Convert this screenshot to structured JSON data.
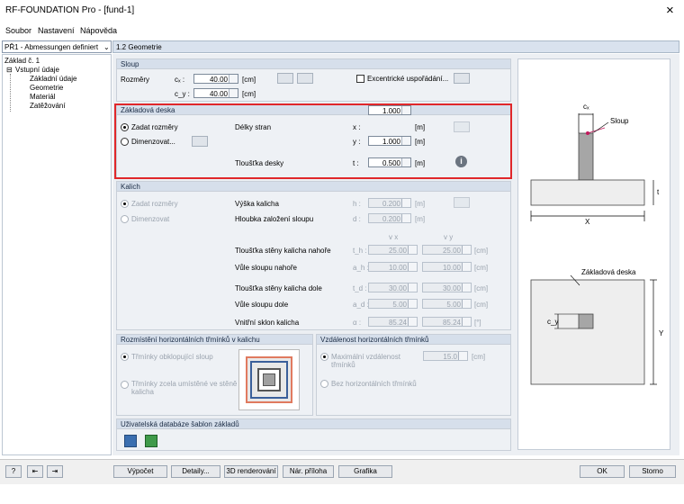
{
  "window": {
    "title": "RF-FOUNDATION Pro - [fund-1]",
    "close": "×"
  },
  "menu": [
    "Soubor",
    "Nastavení",
    "Nápověda"
  ],
  "case_combo": "PŘ1 - Abmessungen definiert",
  "pane_title": "1.2 Geometrie",
  "tree": {
    "root": "Základ č. 1",
    "input": "Vstupní údaje",
    "items": [
      "Základní údaje",
      "Geometrie",
      "Materiál",
      "Zatěžování"
    ]
  },
  "sloup": {
    "title": "Sloup",
    "rozmery": "Rozměry",
    "cx_label": "cₓ :",
    "cy_label": "c_y :",
    "cx": "40.00",
    "cy": "40.00",
    "unit": "[cm]",
    "excentric": "Excentrické uspořádání..."
  },
  "deska": {
    "title": "Základová deska",
    "zadat": "Zadat rozměry",
    "dimenzovat": "Dimenzovat...",
    "delky": "Délky stran",
    "x_label": "x :",
    "y_label": "y :",
    "x": "1.000",
    "y": "1.000",
    "unit": "[m]",
    "tloustka": "Tloušťka desky",
    "t_label": "t :",
    "t": "0.500"
  },
  "kalich": {
    "title": "Kalich",
    "zadat": "Zadat rozměry",
    "dimenzovat": "Dimenzovat",
    "vyska": "Výška kalicha",
    "h_label": "h :",
    "h": "0.200",
    "hloubka": "Hloubka založení sloupu",
    "d_label": "d :",
    "d": "0.200",
    "unit_m": "[m]",
    "unit_cm": "[cm]",
    "unit_deg": "[°]",
    "col_x": "v x",
    "col_y": "v y",
    "rows": [
      {
        "label": "Tloušťka stěny kalicha nahoře",
        "sym": "t_h :",
        "x": "25.00",
        "y": "25.00",
        "unit": "[cm]"
      },
      {
        "label": "Vůle sloupu nahoře",
        "sym": "a_h :",
        "x": "10.00",
        "y": "10.00",
        "unit": "[cm]"
      },
      {
        "label": "Tloušťka stěny kalicha dole",
        "sym": "t_d :",
        "x": "30.00",
        "y": "30.00",
        "unit": "[cm]"
      },
      {
        "label": "Vůle sloupu dole",
        "sym": "a_d :",
        "x": "5.00",
        "y": "5.00",
        "unit": "[cm]"
      },
      {
        "label": "Vnitřní sklon kalicha",
        "sym": "α :",
        "x": "85.24",
        "y": "85.24",
        "unit": "[°]"
      }
    ]
  },
  "rozmisteni": {
    "title": "Rozmístění horizontálních třmínků v kalichu",
    "opt1": "Třmínky obklopující sloup",
    "opt2a": "Třmínky zcela umístěné ve stěně",
    "opt2b": "kalicha"
  },
  "vzdalenost": {
    "title": "Vzdálenost horizontálních třmínků",
    "opt1a": "Maximální vzdálenost",
    "opt1b": "třmínků",
    "value": "15.0",
    "unit": "[cm]",
    "opt2": "Bez horizontálních třmínků"
  },
  "db": {
    "title": "Uživatelská databáze šablon základů"
  },
  "sketch": {
    "cx": "cₓ",
    "sloup": "Sloup",
    "t": "t",
    "x": "X",
    "deska": "Základová deska",
    "cy": "c_y",
    "y": "Y"
  },
  "buttons": {
    "vypocet": "Výpočet",
    "detaily": "Detaily...",
    "render": "3D renderování",
    "priloha": "Nár. příloha",
    "grafika": "Grafika",
    "ok": "OK",
    "storno": "Storno"
  }
}
